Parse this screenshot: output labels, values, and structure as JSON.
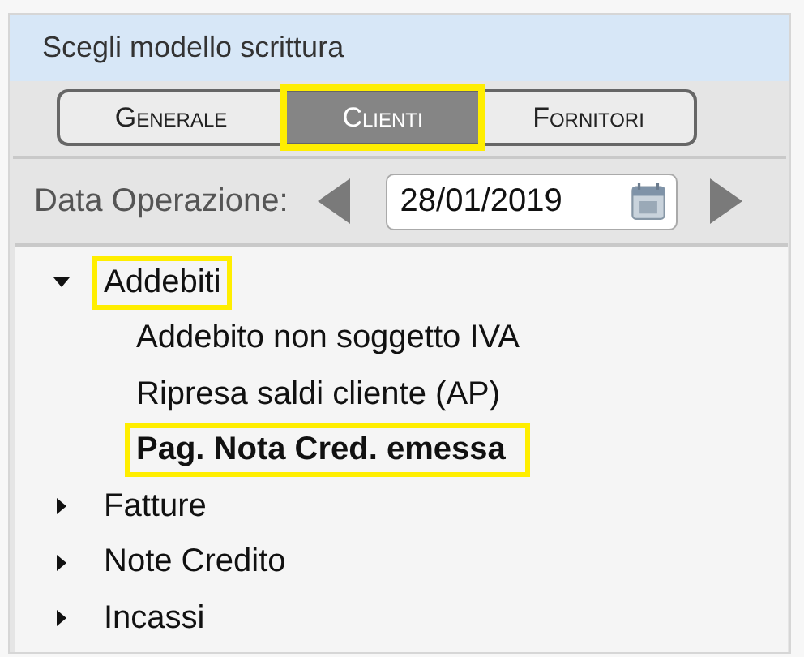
{
  "panel": {
    "title": "Scegli modello scrittura"
  },
  "tabs": [
    {
      "label": "Generale",
      "selected": false,
      "highlighted": false
    },
    {
      "label": "Clienti",
      "selected": true,
      "highlighted": true
    },
    {
      "label": "Fornitori",
      "selected": false,
      "highlighted": false
    }
  ],
  "date": {
    "label": "Data Operazione:",
    "value": "28/01/2019"
  },
  "tree": [
    {
      "label": "Addebiti",
      "expanded": true,
      "selected": false,
      "highlighted": true,
      "children": [
        {
          "label": "Addebito non soggetto IVA",
          "selected": false,
          "highlighted": false
        },
        {
          "label": "Ripresa saldi cliente (AP)",
          "selected": false,
          "highlighted": false
        },
        {
          "label": "Pag. Nota Cred. emessa",
          "selected": true,
          "highlighted": true
        }
      ]
    },
    {
      "label": "Fatture",
      "expanded": false,
      "selected": false,
      "highlighted": false
    },
    {
      "label": "Note Credito",
      "expanded": false,
      "selected": false,
      "highlighted": false
    },
    {
      "label": "Incassi",
      "expanded": false,
      "selected": false,
      "highlighted": false
    }
  ]
}
